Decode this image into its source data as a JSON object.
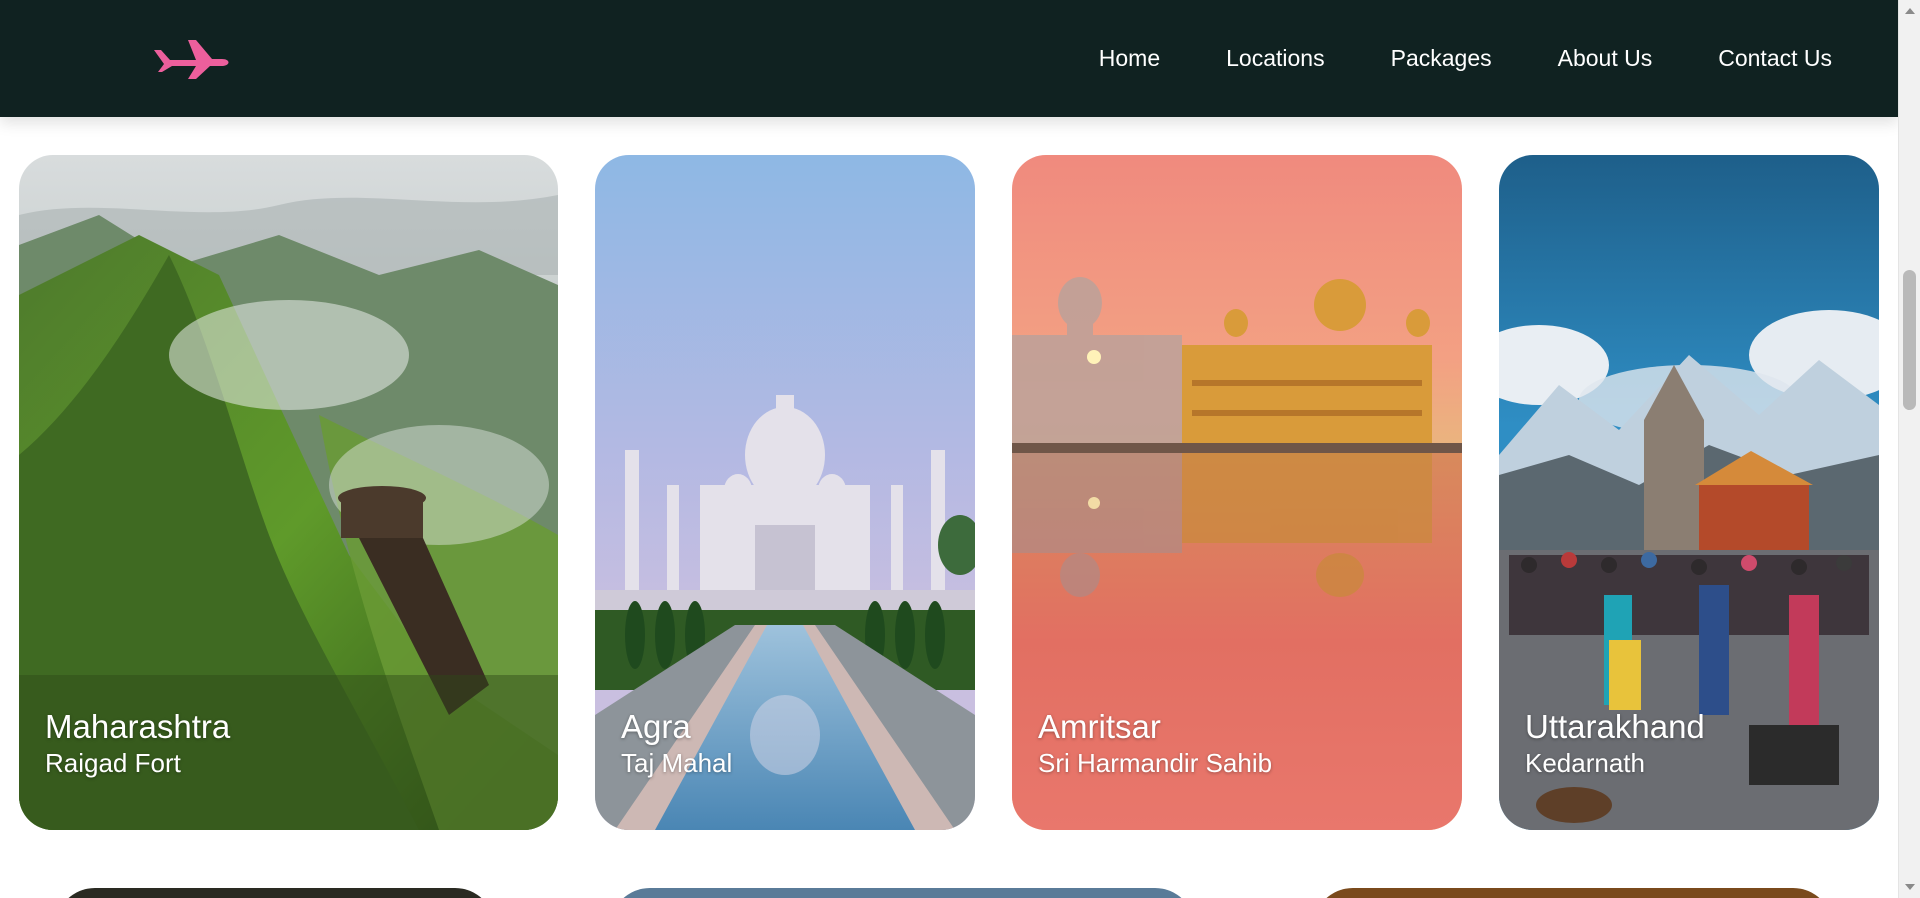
{
  "nav": {
    "logo_icon": "airplane-icon",
    "logo_color": "#ec5f9c",
    "links": [
      "Home",
      "Locations",
      "Packages",
      "About Us",
      "Contact Us"
    ]
  },
  "cards": [
    {
      "title": "Maharashtra",
      "subtitle": "Raigad Fort"
    },
    {
      "title": "Agra",
      "subtitle": "Taj Mahal"
    },
    {
      "title": "Amritsar",
      "subtitle": "Sri Harmandir Sahib"
    },
    {
      "title": "Uttarakhand",
      "subtitle": "Kedarnath"
    }
  ],
  "colors": {
    "navbar_bg": "#102221",
    "nav_text": "#ffffff"
  }
}
